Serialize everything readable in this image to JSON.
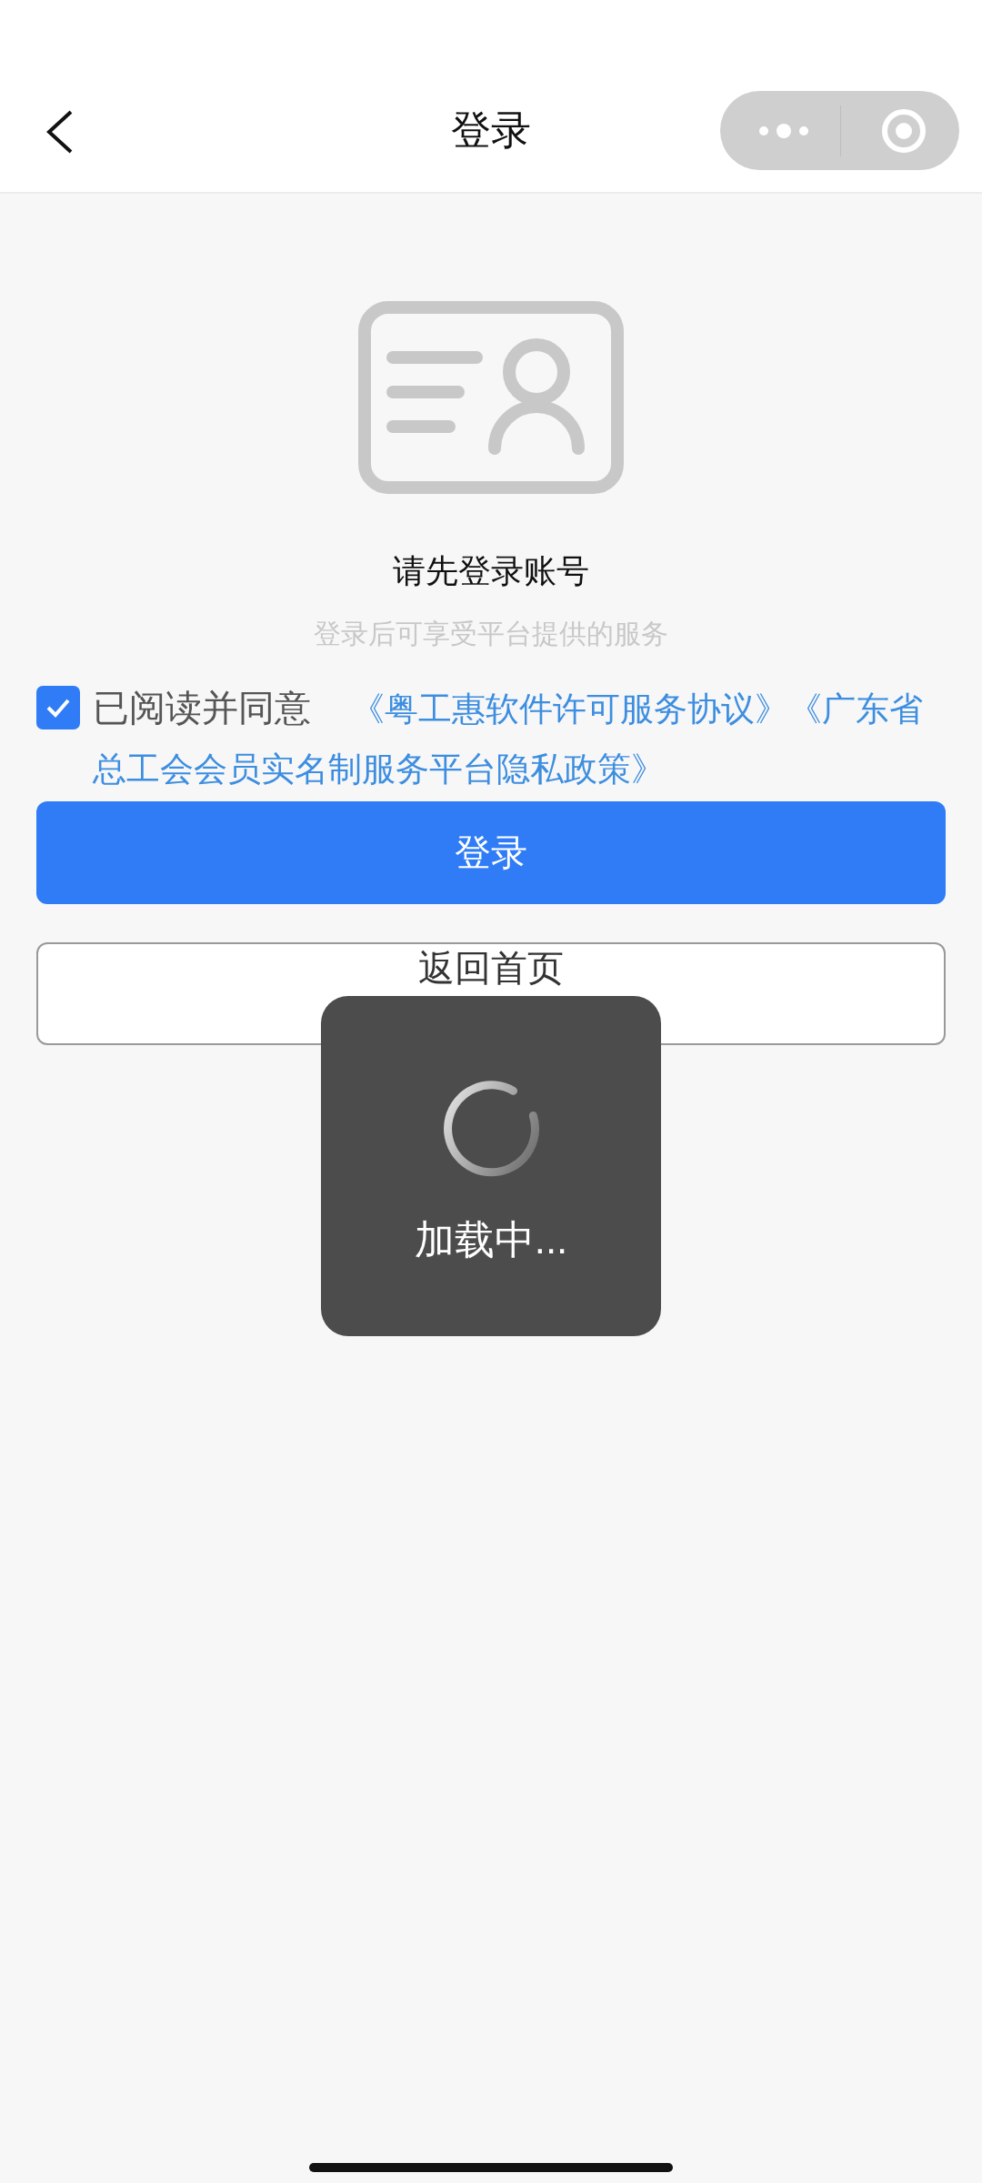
{
  "nav": {
    "title": "登录"
  },
  "prompt": {
    "title": "请先登录账号",
    "subtitle": "登录后可享受平台提供的服务"
  },
  "agreement": {
    "checked": true,
    "label": "已阅读并同意",
    "links": [
      "《粤工惠软件许可服务协议》",
      "《广东省总工会会员实名制服务平台隐私政策》"
    ]
  },
  "buttons": [
    {
      "kind": "primary",
      "label": "登录"
    },
    {
      "kind": "outline",
      "label": "返回首页"
    }
  ],
  "toast": {
    "text": "加载中..."
  }
}
